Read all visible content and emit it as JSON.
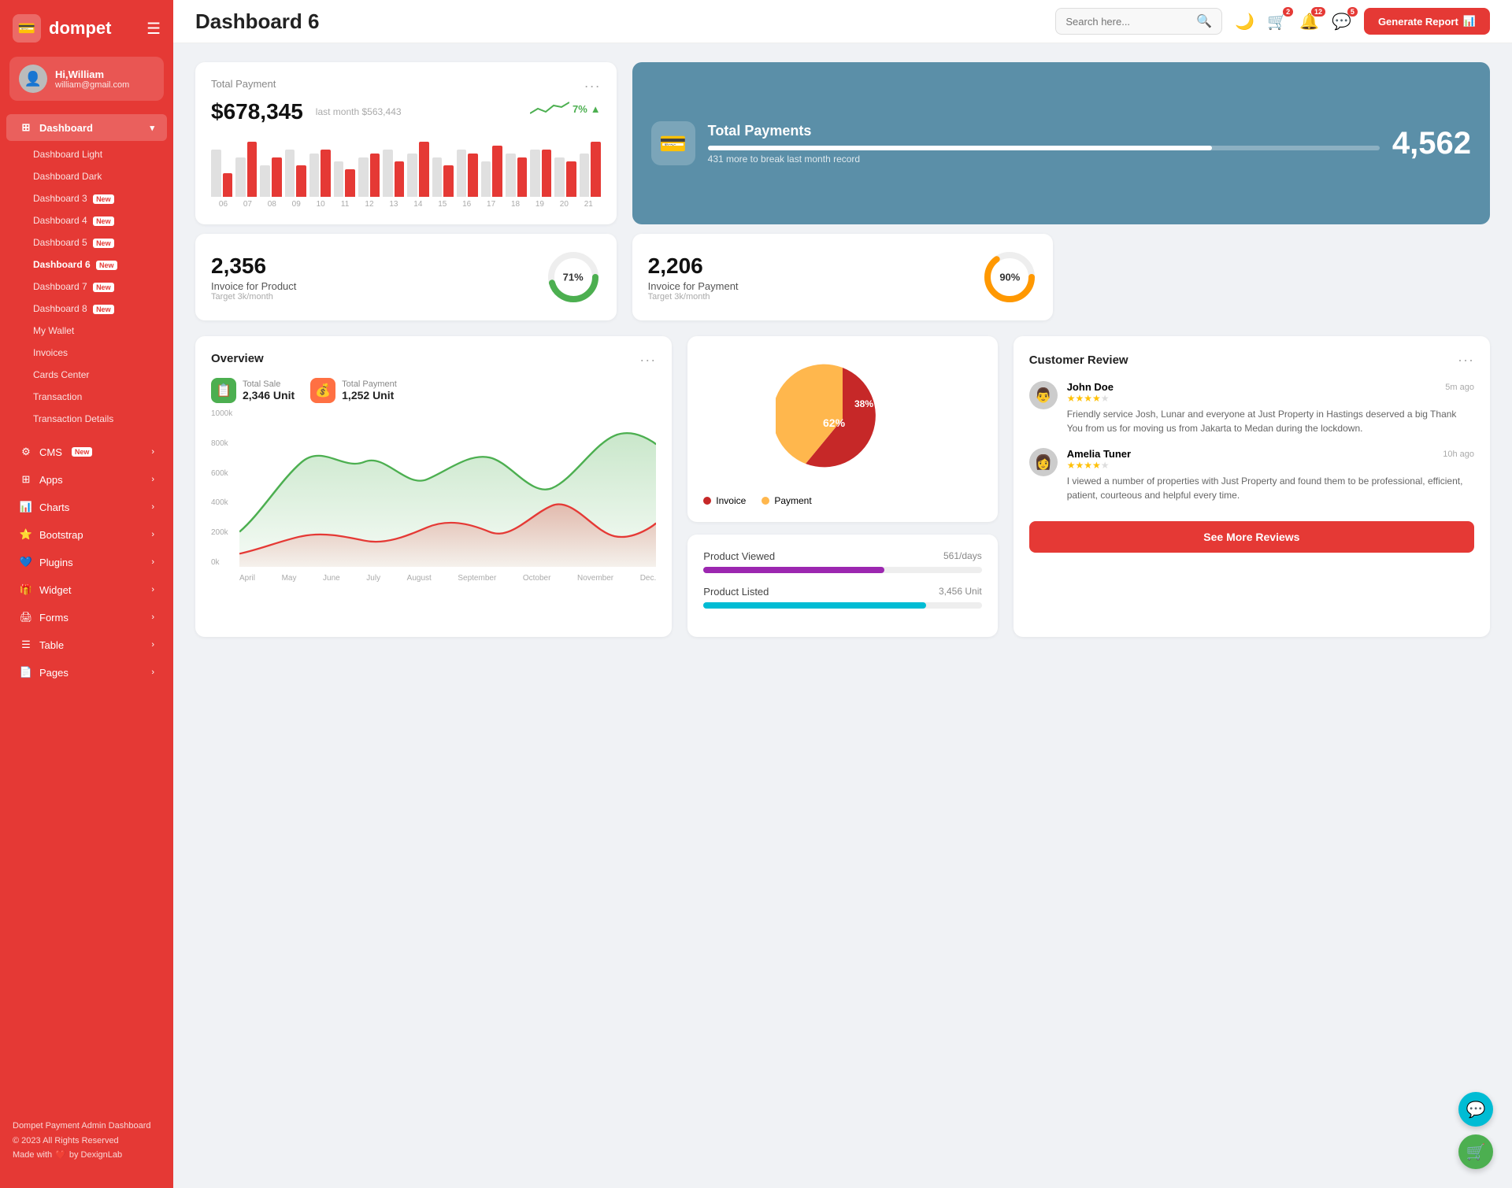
{
  "brand": {
    "name": "dompet",
    "icon": "💳"
  },
  "user": {
    "greeting": "Hi,William",
    "email": "william@gmail.com",
    "avatar": "👤"
  },
  "topbar": {
    "title": "Dashboard 6",
    "search_placeholder": "Search here...",
    "generate_btn": "Generate Report"
  },
  "topbar_icons": {
    "moon": "🌙",
    "cart_badge": "2",
    "bell_badge": "12",
    "chat_badge": "5"
  },
  "sidebar": {
    "dashboard_label": "Dashboard",
    "items": [
      {
        "label": "Dashboard Light",
        "id": "dashboard-light"
      },
      {
        "label": "Dashboard Dark",
        "id": "dashboard-dark"
      },
      {
        "label": "Dashboard 3",
        "id": "dashboard-3",
        "badge": "New"
      },
      {
        "label": "Dashboard 4",
        "id": "dashboard-4",
        "badge": "New"
      },
      {
        "label": "Dashboard 5",
        "id": "dashboard-5",
        "badge": "New"
      },
      {
        "label": "Dashboard 6",
        "id": "dashboard-6",
        "badge": "New",
        "active": true
      },
      {
        "label": "Dashboard 7",
        "id": "dashboard-7",
        "badge": "New"
      },
      {
        "label": "Dashboard 8",
        "id": "dashboard-8",
        "badge": "New"
      },
      {
        "label": "My Wallet",
        "id": "my-wallet"
      },
      {
        "label": "Invoices",
        "id": "invoices"
      },
      {
        "label": "Cards Center",
        "id": "cards-center"
      },
      {
        "label": "Transaction",
        "id": "transaction"
      },
      {
        "label": "Transaction Details",
        "id": "transaction-details"
      }
    ],
    "nav_items": [
      {
        "label": "CMS",
        "id": "cms",
        "badge": "New",
        "icon": "⚙️"
      },
      {
        "label": "Apps",
        "id": "apps",
        "icon": "📦"
      },
      {
        "label": "Charts",
        "id": "charts",
        "icon": "📊"
      },
      {
        "label": "Bootstrap",
        "id": "bootstrap",
        "icon": "⭐"
      },
      {
        "label": "Plugins",
        "id": "plugins",
        "icon": "💙"
      },
      {
        "label": "Widget",
        "id": "widget",
        "icon": "🎁"
      },
      {
        "label": "Forms",
        "id": "forms",
        "icon": "🖨️"
      },
      {
        "label": "Table",
        "id": "table",
        "icon": "☰"
      },
      {
        "label": "Pages",
        "id": "pages",
        "icon": "📄"
      }
    ],
    "footer": {
      "brand": "Dompet Payment Admin Dashboard",
      "copyright": "© 2023 All Rights Reserved",
      "made_with": "Made with",
      "heart": "❤️",
      "by": "by DexignLab"
    }
  },
  "total_payment": {
    "title": "Total Payment",
    "amount": "$678,345",
    "last_month_label": "last month $563,443",
    "trend_pct": "7%",
    "bars": [
      {
        "gray": 60,
        "red": 30
      },
      {
        "gray": 50,
        "red": 70
      },
      {
        "gray": 40,
        "red": 50
      },
      {
        "gray": 60,
        "red": 40
      },
      {
        "gray": 55,
        "red": 60
      },
      {
        "gray": 45,
        "red": 35
      },
      {
        "gray": 50,
        "red": 55
      },
      {
        "gray": 60,
        "red": 45
      },
      {
        "gray": 55,
        "red": 70
      },
      {
        "gray": 50,
        "red": 40
      },
      {
        "gray": 60,
        "red": 55
      },
      {
        "gray": 45,
        "red": 65
      },
      {
        "gray": 55,
        "red": 50
      },
      {
        "gray": 60,
        "red": 60
      },
      {
        "gray": 50,
        "red": 45
      },
      {
        "gray": 55,
        "red": 70
      }
    ],
    "bar_labels": [
      "06",
      "07",
      "08",
      "09",
      "10",
      "11",
      "12",
      "13",
      "14",
      "15",
      "16",
      "17",
      "18",
      "19",
      "20",
      "21"
    ]
  },
  "total_payments_card": {
    "title": "Total Payments",
    "number": "4,562",
    "sub": "431 more to break last month record",
    "progress_pct": 75
  },
  "invoice_product": {
    "number": "2,356",
    "label": "Invoice for Product",
    "target": "Target 3k/month",
    "pct": 71,
    "color": "#4caf50"
  },
  "invoice_payment": {
    "number": "2,206",
    "label": "Invoice for Payment",
    "target": "Target 3k/month",
    "pct": 90,
    "color": "#ff9800"
  },
  "overview": {
    "title": "Overview",
    "total_sale_label": "Total Sale",
    "total_sale_value": "2,346 Unit",
    "total_payment_label": "Total Payment",
    "total_payment_value": "1,252 Unit",
    "y_labels": [
      "1000k",
      "800k",
      "600k",
      "400k",
      "200k",
      "0k"
    ],
    "x_labels": [
      "April",
      "May",
      "June",
      "July",
      "August",
      "September",
      "October",
      "November",
      "Dec."
    ]
  },
  "pie_chart": {
    "invoice_pct": "62%",
    "payment_pct": "38%",
    "invoice_label": "Invoice",
    "payment_label": "Payment",
    "invoice_color": "#c62828",
    "payment_color": "#ffb74d"
  },
  "product_stats": {
    "product_viewed_label": "Product Viewed",
    "product_viewed_value": "561/days",
    "product_viewed_pct": 65,
    "product_listed_label": "Product Listed",
    "product_listed_value": "3,456 Unit",
    "product_listed_pct": 80
  },
  "reviews": {
    "title": "Customer Review",
    "see_more_btn": "See More Reviews",
    "items": [
      {
        "name": "John Doe",
        "time": "5m ago",
        "stars": 4,
        "text": "Friendly service Josh, Lunar and everyone at Just Property in Hastings deserved a big Thank You from us for moving us from Jakarta to Medan during the lockdown.",
        "avatar": "👨"
      },
      {
        "name": "Amelia Tuner",
        "time": "10h ago",
        "stars": 4,
        "text": "I viewed a number of properties with Just Property and found them to be professional, efficient, patient, courteous and helpful every time.",
        "avatar": "👩"
      }
    ]
  }
}
